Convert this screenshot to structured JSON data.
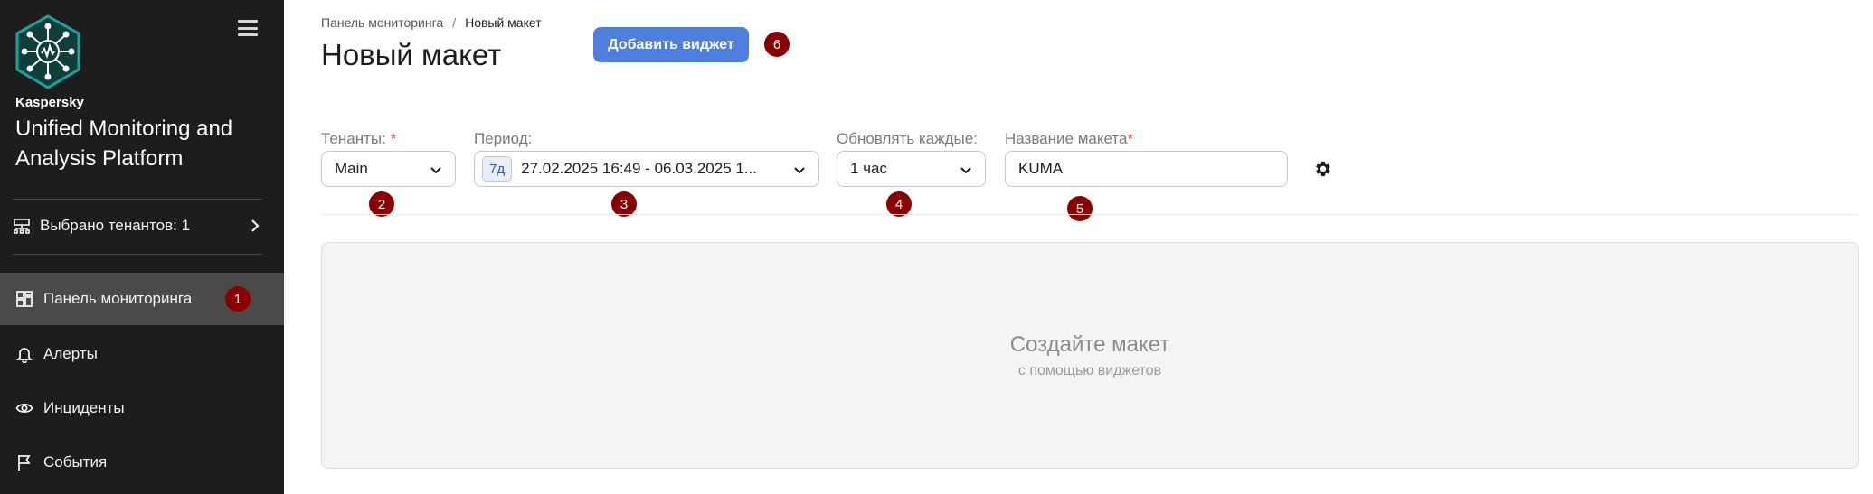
{
  "sidebar": {
    "brand_small": "Kaspersky",
    "brand_big": "Unified Monitoring and Analysis Platform",
    "tenants_selected": "Выбрано тенантов: 1",
    "items": [
      {
        "label": "Панель мониторинга",
        "icon": "dashboard-icon",
        "active": true,
        "badge": "1"
      },
      {
        "label": "Алерты",
        "icon": "bell-icon"
      },
      {
        "label": "Инциденты",
        "icon": "eye-icon"
      },
      {
        "label": "События",
        "icon": "flag-icon"
      }
    ]
  },
  "breadcrumb": {
    "parent": "Панель мониторинга",
    "separator": "/",
    "current": "Новый макет"
  },
  "page_title": "Новый макет",
  "add_widget_button": {
    "label": "Добавить виджет",
    "badge": "6"
  },
  "filters": {
    "tenants": {
      "label": "Тенанты:",
      "required_mark": "*",
      "value": "Main",
      "badge": "2"
    },
    "period": {
      "label": "Период:",
      "tag": "7д",
      "value": "27.02.2025 16:49 - 06.03.2025 1...",
      "badge": "3"
    },
    "refresh": {
      "label": "Обновлять каждые:",
      "value": "1 час",
      "badge": "4"
    },
    "layout_name": {
      "label": "Название макета",
      "required_mark": "*",
      "value": "KUMA",
      "badge": "5"
    }
  },
  "canvas": {
    "title": "Создайте макет",
    "subtitle": "с помощью виджетов"
  },
  "colors": {
    "sidebar_bg": "#1d1d1b",
    "sidebar_active": "#4a4a48",
    "accent_button": "#4f7fdc",
    "badge": "#8a0000",
    "logo_teal": "#1aa39c"
  }
}
